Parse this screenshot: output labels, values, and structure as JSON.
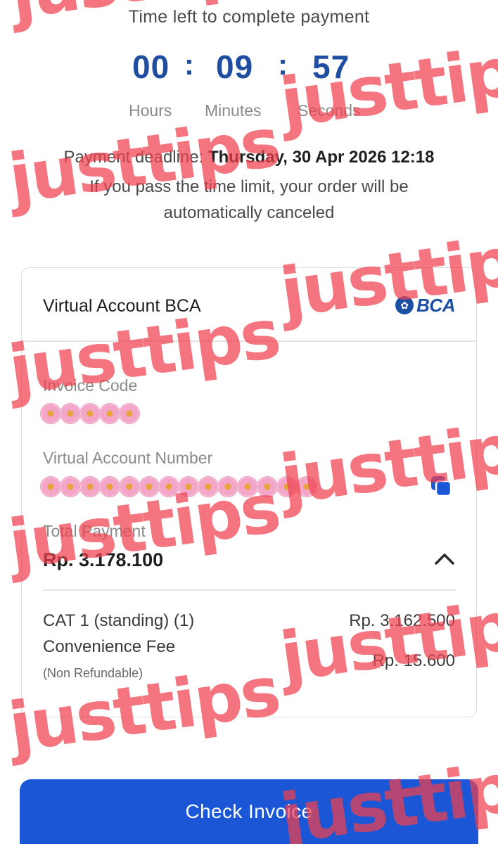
{
  "header": {
    "time_left_label": "Time left to complete payment",
    "countdown": {
      "hours": "00",
      "minutes": "09",
      "seconds": "57",
      "separator": ":",
      "hours_label": "Hours",
      "minutes_label": "Minutes",
      "seconds_label": "Seconds"
    },
    "deadline_label": "Payment deadline: ",
    "deadline_value": "Thursday, 30 Apr 2026 12:18",
    "warning": "If you pass the time limit, your order will be automatically canceled"
  },
  "payment_card": {
    "title": "Virtual Account BCA",
    "bank_logo_text": "BCA",
    "invoice_code_label": "Invoice Code",
    "virtual_account_label": "Virtual Account Number",
    "total_payment_label": "Total Payment",
    "total_payment_value": "Rp. 3.178.100",
    "items": [
      {
        "label": "CAT 1 (standing) (1)",
        "value": "Rp. 3.162.500"
      },
      {
        "label": "Convenience Fee",
        "value": "Rp. 15.600"
      }
    ],
    "fee_note": "(Non Refundable)"
  },
  "actions": {
    "check_invoice_label": "Check Invoice"
  },
  "watermark": {
    "text": "justtips"
  },
  "icons": {
    "copy": "copy-icon",
    "chevron": "chevron-up-icon",
    "redaction": "flower-sticker"
  },
  "colors": {
    "countdown": "#1f4ea0",
    "primary_button": "#1a56d6",
    "watermark": "#f0414e",
    "bca_brand": "#1b4fa3"
  }
}
